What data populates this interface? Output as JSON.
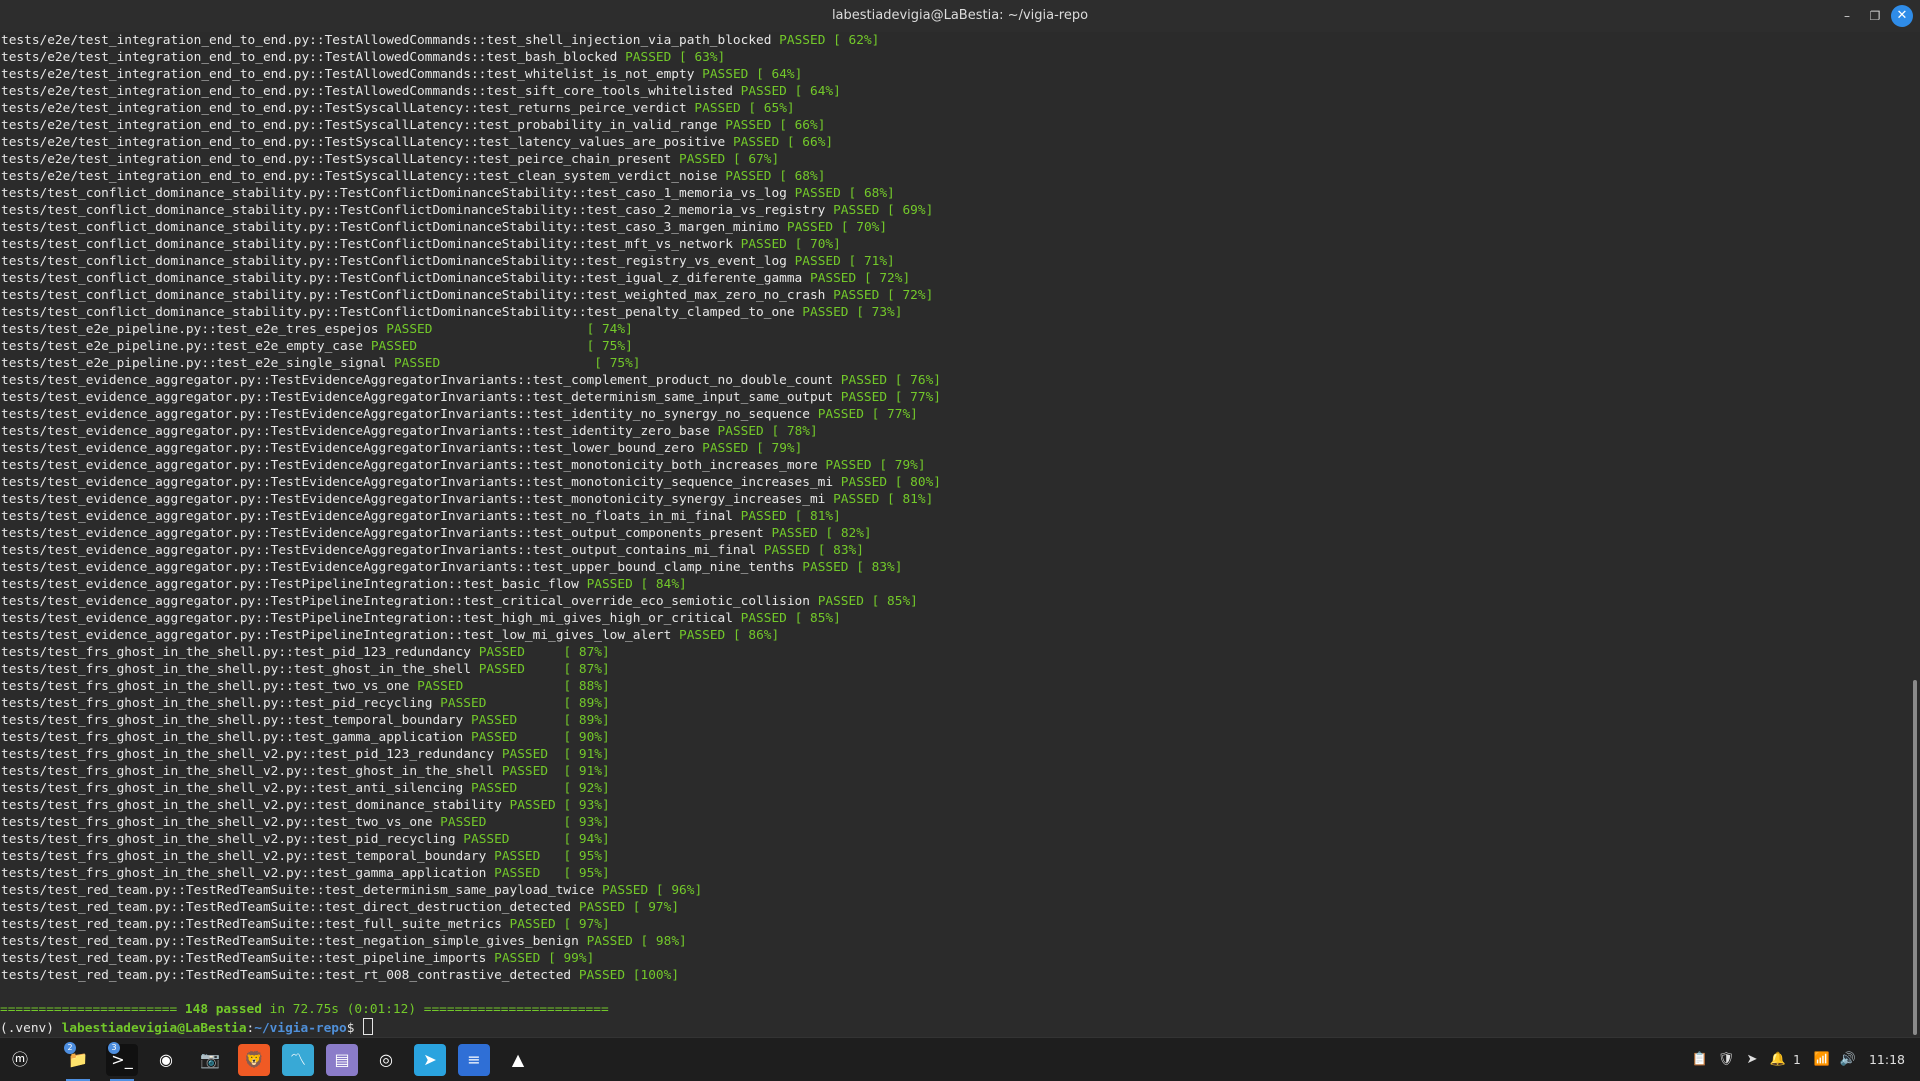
{
  "window": {
    "title": "labestiadevigia@LaBestia: ~/vigia-repo",
    "minimize_label": "–",
    "maximize_label": "❐",
    "close_label": "✕"
  },
  "terminal": {
    "passed_label": "PASSED",
    "lines": [
      {
        "path": "tests/e2e/test_integration_end_to_end.py::TestAllowedCommands::test_shell_injection_via_path_blocked",
        "gap": " ",
        "pct": "[ 62%]"
      },
      {
        "path": "tests/e2e/test_integration_end_to_end.py::TestAllowedCommands::test_bash_blocked",
        "gap": " ",
        "pct": "[ 63%]"
      },
      {
        "path": "tests/e2e/test_integration_end_to_end.py::TestAllowedCommands::test_whitelist_is_not_empty",
        "gap": " ",
        "pct": "[ 64%]"
      },
      {
        "path": "tests/e2e/test_integration_end_to_end.py::TestAllowedCommands::test_sift_core_tools_whitelisted",
        "gap": " ",
        "pct": "[ 64%]"
      },
      {
        "path": "tests/e2e/test_integration_end_to_end.py::TestSyscallLatency::test_returns_peirce_verdict",
        "gap": " ",
        "pct": "[ 65%]"
      },
      {
        "path": "tests/e2e/test_integration_end_to_end.py::TestSyscallLatency::test_probability_in_valid_range",
        "gap": " ",
        "pct": "[ 66%]"
      },
      {
        "path": "tests/e2e/test_integration_end_to_end.py::TestSyscallLatency::test_latency_values_are_positive",
        "gap": " ",
        "pct": "[ 66%]"
      },
      {
        "path": "tests/e2e/test_integration_end_to_end.py::TestSyscallLatency::test_peirce_chain_present",
        "gap": " ",
        "pct": "[ 67%]"
      },
      {
        "path": "tests/e2e/test_integration_end_to_end.py::TestSyscallLatency::test_clean_system_verdict_noise",
        "gap": " ",
        "pct": "[ 68%]"
      },
      {
        "path": "tests/test_conflict_dominance_stability.py::TestConflictDominanceStability::test_caso_1_memoria_vs_log",
        "gap": " ",
        "pct": "[ 68%]"
      },
      {
        "path": "tests/test_conflict_dominance_stability.py::TestConflictDominanceStability::test_caso_2_memoria_vs_registry",
        "gap": " ",
        "pct": "[ 69%]"
      },
      {
        "path": "tests/test_conflict_dominance_stability.py::TestConflictDominanceStability::test_caso_3_margen_minimo",
        "gap": " ",
        "pct": "[ 70%]"
      },
      {
        "path": "tests/test_conflict_dominance_stability.py::TestConflictDominanceStability::test_mft_vs_network",
        "gap": " ",
        "pct": "[ 70%]"
      },
      {
        "path": "tests/test_conflict_dominance_stability.py::TestConflictDominanceStability::test_registry_vs_event_log",
        "gap": " ",
        "pct": "[ 71%]"
      },
      {
        "path": "tests/test_conflict_dominance_stability.py::TestConflictDominanceStability::test_igual_z_diferente_gamma",
        "gap": " ",
        "pct": "[ 72%]"
      },
      {
        "path": "tests/test_conflict_dominance_stability.py::TestConflictDominanceStability::test_weighted_max_zero_no_crash",
        "gap": " ",
        "pct": "[ 72%]"
      },
      {
        "path": "tests/test_conflict_dominance_stability.py::TestConflictDominanceStability::test_penalty_clamped_to_one",
        "gap": " ",
        "pct": "[ 73%]"
      },
      {
        "path": "tests/test_e2e_pipeline.py::test_e2e_tres_espejos",
        "gap": "                    ",
        "pct": "[ 74%]"
      },
      {
        "path": "tests/test_e2e_pipeline.py::test_e2e_empty_case",
        "gap": "                      ",
        "pct": "[ 75%]"
      },
      {
        "path": "tests/test_e2e_pipeline.py::test_e2e_single_signal",
        "gap": "                    ",
        "pct": "[ 75%]"
      },
      {
        "path": "tests/test_evidence_aggregator.py::TestEvidenceAggregatorInvariants::test_complement_product_no_double_count",
        "gap": " ",
        "pct": "[ 76%]"
      },
      {
        "path": "tests/test_evidence_aggregator.py::TestEvidenceAggregatorInvariants::test_determinism_same_input_same_output",
        "gap": " ",
        "pct": "[ 77%]"
      },
      {
        "path": "tests/test_evidence_aggregator.py::TestEvidenceAggregatorInvariants::test_identity_no_synergy_no_sequence",
        "gap": " ",
        "pct": "[ 77%]"
      },
      {
        "path": "tests/test_evidence_aggregator.py::TestEvidenceAggregatorInvariants::test_identity_zero_base",
        "gap": " ",
        "pct": "[ 78%]"
      },
      {
        "path": "tests/test_evidence_aggregator.py::TestEvidenceAggregatorInvariants::test_lower_bound_zero",
        "gap": " ",
        "pct": "[ 79%]"
      },
      {
        "path": "tests/test_evidence_aggregator.py::TestEvidenceAggregatorInvariants::test_monotonicity_both_increases_more",
        "gap": " ",
        "pct": "[ 79%]"
      },
      {
        "path": "tests/test_evidence_aggregator.py::TestEvidenceAggregatorInvariants::test_monotonicity_sequence_increases_mi",
        "gap": " ",
        "pct": "[ 80%]"
      },
      {
        "path": "tests/test_evidence_aggregator.py::TestEvidenceAggregatorInvariants::test_monotonicity_synergy_increases_mi",
        "gap": " ",
        "pct": "[ 81%]"
      },
      {
        "path": "tests/test_evidence_aggregator.py::TestEvidenceAggregatorInvariants::test_no_floats_in_mi_final",
        "gap": " ",
        "pct": "[ 81%]"
      },
      {
        "path": "tests/test_evidence_aggregator.py::TestEvidenceAggregatorInvariants::test_output_components_present",
        "gap": " ",
        "pct": "[ 82%]"
      },
      {
        "path": "tests/test_evidence_aggregator.py::TestEvidenceAggregatorInvariants::test_output_contains_mi_final",
        "gap": " ",
        "pct": "[ 83%]"
      },
      {
        "path": "tests/test_evidence_aggregator.py::TestEvidenceAggregatorInvariants::test_upper_bound_clamp_nine_tenths",
        "gap": " ",
        "pct": "[ 83%]"
      },
      {
        "path": "tests/test_evidence_aggregator.py::TestPipelineIntegration::test_basic_flow",
        "gap": " ",
        "pct": "[ 84%]"
      },
      {
        "path": "tests/test_evidence_aggregator.py::TestPipelineIntegration::test_critical_override_eco_semiotic_collision",
        "gap": " ",
        "pct": "[ 85%]"
      },
      {
        "path": "tests/test_evidence_aggregator.py::TestPipelineIntegration::test_high_mi_gives_high_or_critical",
        "gap": " ",
        "pct": "[ 85%]"
      },
      {
        "path": "tests/test_evidence_aggregator.py::TestPipelineIntegration::test_low_mi_gives_low_alert",
        "gap": " ",
        "pct": "[ 86%]"
      },
      {
        "path": "tests/test_frs_ghost_in_the_shell.py::test_pid_123_redundancy",
        "gap": "     ",
        "pct": "[ 87%]"
      },
      {
        "path": "tests/test_frs_ghost_in_the_shell.py::test_ghost_in_the_shell",
        "gap": "     ",
        "pct": "[ 87%]"
      },
      {
        "path": "tests/test_frs_ghost_in_the_shell.py::test_two_vs_one",
        "gap": "             ",
        "pct": "[ 88%]"
      },
      {
        "path": "tests/test_frs_ghost_in_the_shell.py::test_pid_recycling",
        "gap": "          ",
        "pct": "[ 89%]"
      },
      {
        "path": "tests/test_frs_ghost_in_the_shell.py::test_temporal_boundary",
        "gap": "      ",
        "pct": "[ 89%]"
      },
      {
        "path": "tests/test_frs_ghost_in_the_shell.py::test_gamma_application",
        "gap": "      ",
        "pct": "[ 90%]"
      },
      {
        "path": "tests/test_frs_ghost_in_the_shell_v2.py::test_pid_123_redundancy",
        "gap": "  ",
        "pct": "[ 91%]"
      },
      {
        "path": "tests/test_frs_ghost_in_the_shell_v2.py::test_ghost_in_the_shell",
        "gap": "  ",
        "pct": "[ 91%]"
      },
      {
        "path": "tests/test_frs_ghost_in_the_shell_v2.py::test_anti_silencing",
        "gap": "      ",
        "pct": "[ 92%]"
      },
      {
        "path": "tests/test_frs_ghost_in_the_shell_v2.py::test_dominance_stability",
        "gap": " ",
        "pct": "[ 93%]"
      },
      {
        "path": "tests/test_frs_ghost_in_the_shell_v2.py::test_two_vs_one",
        "gap": "          ",
        "pct": "[ 93%]"
      },
      {
        "path": "tests/test_frs_ghost_in_the_shell_v2.py::test_pid_recycling",
        "gap": "       ",
        "pct": "[ 94%]"
      },
      {
        "path": "tests/test_frs_ghost_in_the_shell_v2.py::test_temporal_boundary",
        "gap": "   ",
        "pct": "[ 95%]"
      },
      {
        "path": "tests/test_frs_ghost_in_the_shell_v2.py::test_gamma_application",
        "gap": "   ",
        "pct": "[ 95%]"
      },
      {
        "path": "tests/test_red_team.py::TestRedTeamSuite::test_determinism_same_payload_twice",
        "gap": " ",
        "pct": "[ 96%]"
      },
      {
        "path": "tests/test_red_team.py::TestRedTeamSuite::test_direct_destruction_detected",
        "gap": " ",
        "pct": "[ 97%]"
      },
      {
        "path": "tests/test_red_team.py::TestRedTeamSuite::test_full_suite_metrics",
        "gap": " ",
        "pct": "[ 97%]"
      },
      {
        "path": "tests/test_red_team.py::TestRedTeamSuite::test_negation_simple_gives_benign",
        "gap": " ",
        "pct": "[ 98%]"
      },
      {
        "path": "tests/test_red_team.py::TestRedTeamSuite::test_pipeline_imports",
        "gap": " ",
        "pct": "[ 99%]"
      },
      {
        "path": "tests/test_red_team.py::TestRedTeamSuite::test_rt_008_contrastive_detected",
        "gap": " ",
        "pct": "[100%]"
      }
    ],
    "summary": {
      "left_sep": "======================= ",
      "count": "148 passed",
      "timing": " in 72.75s (0:01:12) ",
      "right_sep": "========================"
    },
    "prompt": {
      "venv": "(.venv) ",
      "user": "labestiadevigia@LaBestia",
      "colon": ":",
      "dir": "~/vigia-repo",
      "symbol": "$ "
    }
  },
  "taskbar": {
    "apps": [
      {
        "name": "menu-icon",
        "glyph": "ⓜ",
        "bg": "transparent",
        "badge": ""
      },
      {
        "name": "files-icon",
        "glyph": "📁",
        "bg": "transparent",
        "badge": "2"
      },
      {
        "name": "terminal-icon",
        "glyph": ">_",
        "bg": "#111111",
        "badge": "3"
      },
      {
        "name": "chrome-icon",
        "glyph": "◉",
        "bg": "transparent",
        "badge": ""
      },
      {
        "name": "camera-icon",
        "glyph": "📷",
        "bg": "transparent",
        "badge": ""
      },
      {
        "name": "brave-icon",
        "glyph": "🦁",
        "bg": "#f05a24",
        "badge": ""
      },
      {
        "name": "monitor-icon",
        "glyph": "〽",
        "bg": "#38a9d6",
        "badge": ""
      },
      {
        "name": "notes-icon",
        "glyph": "▤",
        "bg": "#8b7cc9",
        "badge": ""
      },
      {
        "name": "github-icon",
        "glyph": "◎",
        "bg": "transparent",
        "badge": ""
      },
      {
        "name": "telegram-icon",
        "glyph": "➤",
        "bg": "#2aa3df",
        "badge": ""
      },
      {
        "name": "text-editor-icon",
        "glyph": "≡",
        "bg": "#2f6fd6",
        "badge": ""
      },
      {
        "name": "arch-icon",
        "glyph": "▲",
        "bg": "transparent",
        "badge": ""
      }
    ],
    "tray": {
      "clipboard_icon": "📋",
      "shield_icon": "🛡",
      "telegram_icon": "➤",
      "notification_icon": "🔔",
      "notification_count": "1",
      "wifi_icon": "📶",
      "volume_icon": "🔊",
      "clock": "11:18"
    }
  }
}
